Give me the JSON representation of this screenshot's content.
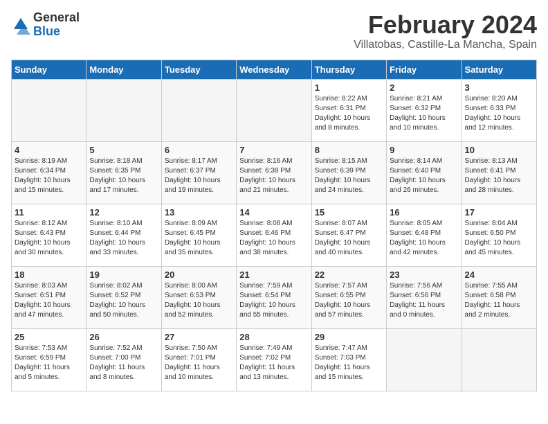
{
  "logo": {
    "general": "General",
    "blue": "Blue"
  },
  "header": {
    "title": "February 2024",
    "subtitle": "Villatobas, Castille-La Mancha, Spain"
  },
  "weekdays": [
    "Sunday",
    "Monday",
    "Tuesday",
    "Wednesday",
    "Thursday",
    "Friday",
    "Saturday"
  ],
  "weeks": [
    [
      {
        "day": "",
        "info": ""
      },
      {
        "day": "",
        "info": ""
      },
      {
        "day": "",
        "info": ""
      },
      {
        "day": "",
        "info": ""
      },
      {
        "day": "1",
        "info": "Sunrise: 8:22 AM\nSunset: 6:31 PM\nDaylight: 10 hours\nand 8 minutes."
      },
      {
        "day": "2",
        "info": "Sunrise: 8:21 AM\nSunset: 6:32 PM\nDaylight: 10 hours\nand 10 minutes."
      },
      {
        "day": "3",
        "info": "Sunrise: 8:20 AM\nSunset: 6:33 PM\nDaylight: 10 hours\nand 12 minutes."
      }
    ],
    [
      {
        "day": "4",
        "info": "Sunrise: 8:19 AM\nSunset: 6:34 PM\nDaylight: 10 hours\nand 15 minutes."
      },
      {
        "day": "5",
        "info": "Sunrise: 8:18 AM\nSunset: 6:35 PM\nDaylight: 10 hours\nand 17 minutes."
      },
      {
        "day": "6",
        "info": "Sunrise: 8:17 AM\nSunset: 6:37 PM\nDaylight: 10 hours\nand 19 minutes."
      },
      {
        "day": "7",
        "info": "Sunrise: 8:16 AM\nSunset: 6:38 PM\nDaylight: 10 hours\nand 21 minutes."
      },
      {
        "day": "8",
        "info": "Sunrise: 8:15 AM\nSunset: 6:39 PM\nDaylight: 10 hours\nand 24 minutes."
      },
      {
        "day": "9",
        "info": "Sunrise: 8:14 AM\nSunset: 6:40 PM\nDaylight: 10 hours\nand 26 minutes."
      },
      {
        "day": "10",
        "info": "Sunrise: 8:13 AM\nSunset: 6:41 PM\nDaylight: 10 hours\nand 28 minutes."
      }
    ],
    [
      {
        "day": "11",
        "info": "Sunrise: 8:12 AM\nSunset: 6:43 PM\nDaylight: 10 hours\nand 30 minutes."
      },
      {
        "day": "12",
        "info": "Sunrise: 8:10 AM\nSunset: 6:44 PM\nDaylight: 10 hours\nand 33 minutes."
      },
      {
        "day": "13",
        "info": "Sunrise: 8:09 AM\nSunset: 6:45 PM\nDaylight: 10 hours\nand 35 minutes."
      },
      {
        "day": "14",
        "info": "Sunrise: 8:08 AM\nSunset: 6:46 PM\nDaylight: 10 hours\nand 38 minutes."
      },
      {
        "day": "15",
        "info": "Sunrise: 8:07 AM\nSunset: 6:47 PM\nDaylight: 10 hours\nand 40 minutes."
      },
      {
        "day": "16",
        "info": "Sunrise: 8:05 AM\nSunset: 6:48 PM\nDaylight: 10 hours\nand 42 minutes."
      },
      {
        "day": "17",
        "info": "Sunrise: 8:04 AM\nSunset: 6:50 PM\nDaylight: 10 hours\nand 45 minutes."
      }
    ],
    [
      {
        "day": "18",
        "info": "Sunrise: 8:03 AM\nSunset: 6:51 PM\nDaylight: 10 hours\nand 47 minutes."
      },
      {
        "day": "19",
        "info": "Sunrise: 8:02 AM\nSunset: 6:52 PM\nDaylight: 10 hours\nand 50 minutes."
      },
      {
        "day": "20",
        "info": "Sunrise: 8:00 AM\nSunset: 6:53 PM\nDaylight: 10 hours\nand 52 minutes."
      },
      {
        "day": "21",
        "info": "Sunrise: 7:59 AM\nSunset: 6:54 PM\nDaylight: 10 hours\nand 55 minutes."
      },
      {
        "day": "22",
        "info": "Sunrise: 7:57 AM\nSunset: 6:55 PM\nDaylight: 10 hours\nand 57 minutes."
      },
      {
        "day": "23",
        "info": "Sunrise: 7:56 AM\nSunset: 6:56 PM\nDaylight: 11 hours\nand 0 minutes."
      },
      {
        "day": "24",
        "info": "Sunrise: 7:55 AM\nSunset: 6:58 PM\nDaylight: 11 hours\nand 2 minutes."
      }
    ],
    [
      {
        "day": "25",
        "info": "Sunrise: 7:53 AM\nSunset: 6:59 PM\nDaylight: 11 hours\nand 5 minutes."
      },
      {
        "day": "26",
        "info": "Sunrise: 7:52 AM\nSunset: 7:00 PM\nDaylight: 11 hours\nand 8 minutes."
      },
      {
        "day": "27",
        "info": "Sunrise: 7:50 AM\nSunset: 7:01 PM\nDaylight: 11 hours\nand 10 minutes."
      },
      {
        "day": "28",
        "info": "Sunrise: 7:49 AM\nSunset: 7:02 PM\nDaylight: 11 hours\nand 13 minutes."
      },
      {
        "day": "29",
        "info": "Sunrise: 7:47 AM\nSunset: 7:03 PM\nDaylight: 11 hours\nand 15 minutes."
      },
      {
        "day": "",
        "info": ""
      },
      {
        "day": "",
        "info": ""
      }
    ]
  ]
}
